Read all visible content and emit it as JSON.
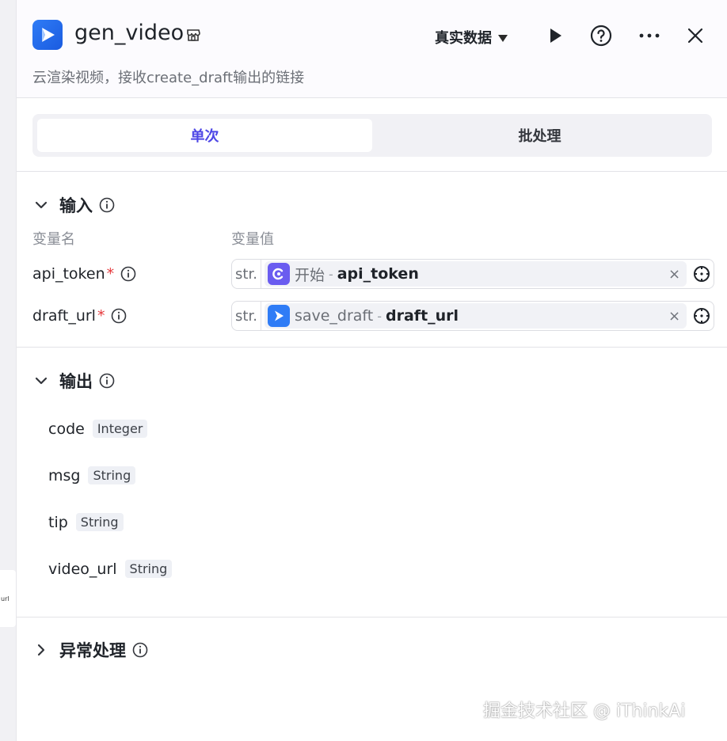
{
  "left_node": {
    "text": "url"
  },
  "header": {
    "title": "gen_video",
    "subtitle": "云渲染视频，接收create_draft输出的链接",
    "data_mode": "真实数据"
  },
  "tabs": [
    {
      "label": "单次",
      "active": true
    },
    {
      "label": "批处理",
      "active": false
    }
  ],
  "input": {
    "title": "输入",
    "col_name": "变量名",
    "col_value": "变量值",
    "rows": [
      {
        "name": "api_token",
        "required_mark": "*",
        "type": "str.",
        "node": "开始",
        "separator": "-",
        "param": "api_token",
        "remove": "×"
      },
      {
        "name": "draft_url",
        "required_mark": "*",
        "type": "str.",
        "node": "save_draft",
        "separator": "-",
        "param": "draft_url",
        "remove": "×"
      }
    ]
  },
  "output": {
    "title": "输出",
    "rows": [
      {
        "name": "code",
        "type": "Integer"
      },
      {
        "name": "msg",
        "type": "String"
      },
      {
        "name": "tip",
        "type": "String"
      },
      {
        "name": "video_url",
        "type": "String"
      }
    ]
  },
  "exception": {
    "title": "异常处理"
  },
  "watermark": "掘金技术社区 @ iThinkAi",
  "colors": {
    "accent": "#4e47e6",
    "logo_blue": "#2f7cf6",
    "start_node_purple": "#6a5cf0",
    "required_red": "#e5383b"
  },
  "icons": [
    "video-logo-icon",
    "store-icon",
    "play-icon",
    "help-icon",
    "more-icon",
    "close-icon",
    "chevron-down-icon",
    "chevron-right-icon",
    "info-icon",
    "target-icon"
  ]
}
